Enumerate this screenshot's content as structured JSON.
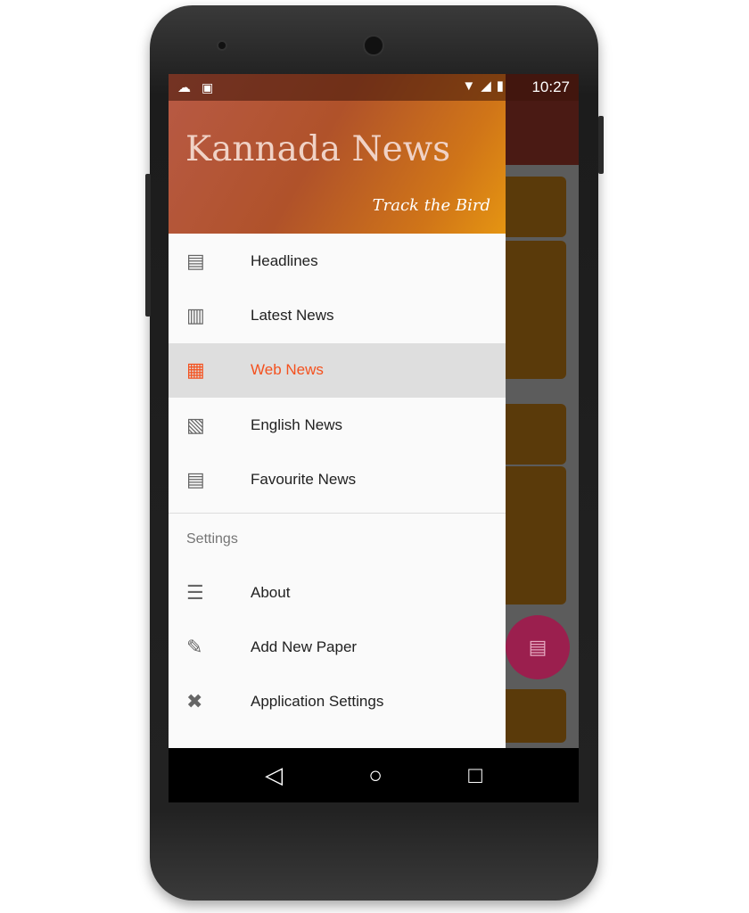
{
  "status_bar": {
    "time": "10:27",
    "icons": [
      "cloud-icon",
      "android-icon",
      "wifi-icon",
      "signal-icon",
      "battery-charging-icon"
    ]
  },
  "drawer": {
    "title": "Kannada News",
    "subtitle": "Track the Bird",
    "items": [
      {
        "label": "Headlines",
        "icon": "newspaper-icon"
      },
      {
        "label": "Latest News",
        "icon": "news-icon"
      },
      {
        "label": "Web News",
        "icon": "web-news-icon",
        "active": true
      },
      {
        "label": "English News",
        "icon": "english-news-icon"
      },
      {
        "label": "Favourite News",
        "icon": "favourite-news-icon"
      }
    ],
    "section_label": "Settings",
    "settings_items": [
      {
        "label": "About",
        "icon": "about-icon"
      },
      {
        "label": "Add New Paper",
        "icon": "edit-icon"
      },
      {
        "label": "Application Settings",
        "icon": "tools-icon"
      }
    ]
  },
  "colors": {
    "accent": "#f4511e",
    "header_start": "#b85a45",
    "header_end": "#e59512"
  }
}
